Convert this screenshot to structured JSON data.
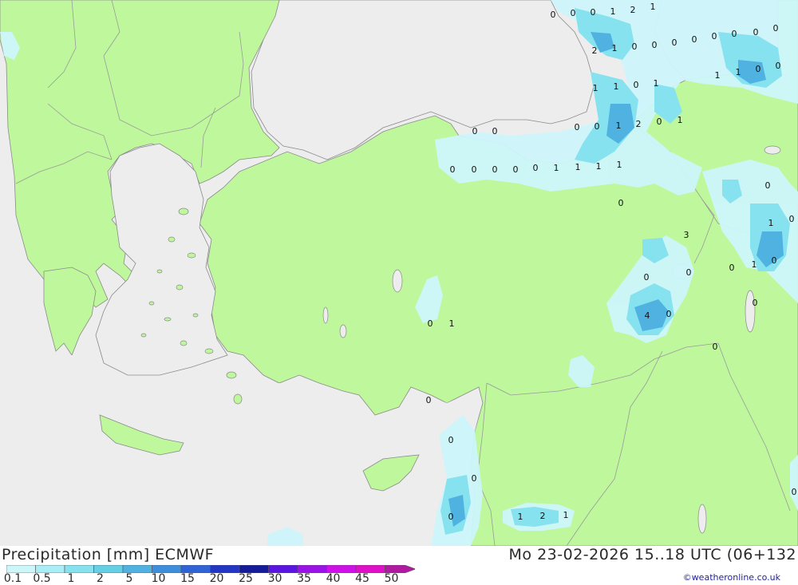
{
  "title": "Precipitation [mm] ECMWF",
  "datetime": "Mo 23-02-2026 15..18 UTC (06+132",
  "credit": "©weatheronline.co.uk",
  "legend": [
    {
      "label": "0.1",
      "color": "#cdf6fb"
    },
    {
      "label": "0.5",
      "color": "#a9eef7"
    },
    {
      "label": "1",
      "color": "#86e2ef"
    },
    {
      "label": "2",
      "color": "#65cfe6"
    },
    {
      "label": "5",
      "color": "#4fb2e0"
    },
    {
      "label": "10",
      "color": "#3d8fde"
    },
    {
      "label": "15",
      "color": "#2f63d6"
    },
    {
      "label": "20",
      "color": "#2436c4"
    },
    {
      "label": "25",
      "color": "#141c9a"
    },
    {
      "label": "30",
      "color": "#5a16e0"
    },
    {
      "label": "35",
      "color": "#9a12e8"
    },
    {
      "label": "40",
      "color": "#d010e8"
    },
    {
      "label": "45",
      "color": "#e010c8"
    },
    {
      "label": "50",
      "color": "#b01aa0"
    }
  ],
  "colors": {
    "land": "#bff79d",
    "sea": "#ededed",
    "border": "#9a9a9a",
    "coast": "#8a8a8a"
  },
  "map_values": [
    "0",
    "0",
    "0",
    "1",
    "2",
    "1",
    "0",
    "2",
    "1",
    "0",
    "0",
    "0",
    "0",
    "0",
    "0",
    "0",
    "0",
    "0",
    "1",
    "1",
    "1",
    "0",
    "1",
    "1",
    "0",
    "0",
    "0",
    "0",
    "1",
    "2",
    "0",
    "1",
    "0",
    "0",
    "0",
    "0",
    "0",
    "1",
    "1",
    "1",
    "1",
    "0",
    "0",
    "1",
    "0",
    "3",
    "0",
    "1",
    "0",
    "0",
    "0",
    "0",
    "0",
    "4",
    "0",
    "1",
    "0",
    "0",
    "0",
    "0",
    "0",
    "1",
    "2",
    "1",
    "0",
    "1",
    "1",
    "0"
  ]
}
